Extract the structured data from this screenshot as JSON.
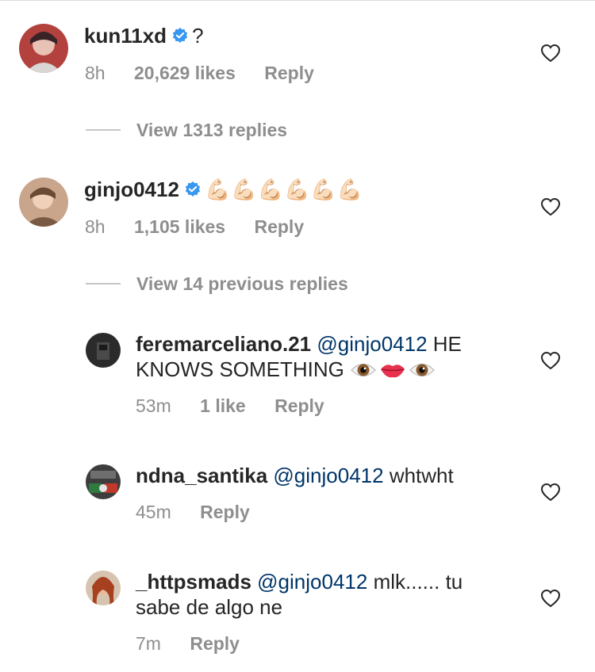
{
  "comments": [
    {
      "username": "kun11xd",
      "text": "?",
      "time": "8h",
      "likes": "20,629 likes",
      "reply": "Reply",
      "view_replies": "View 1313 replies"
    },
    {
      "username": "ginjo0412",
      "emoji": "💪🏻💪🏻💪🏻💪🏻💪🏻💪🏻",
      "time": "8h",
      "likes": "1,105 likes",
      "reply": "Reply",
      "view_replies": "View 14 previous replies"
    }
  ],
  "replies": [
    {
      "username": "feremarceliano.21",
      "mention": "@ginjo0412",
      "text_line1": "HE",
      "text_line2": "KNOWS SOMETHING",
      "time": "53m",
      "likes": "1 like",
      "reply": "Reply"
    },
    {
      "username": "ndna_santika",
      "mention": "@ginjo0412",
      "text": "whtwht",
      "time": "45m",
      "reply": "Reply"
    },
    {
      "username": "_httpsmads",
      "mention": "@ginjo0412",
      "text_line1": "mlk...... tu",
      "text_line2": "sabe de algo ne",
      "time": "7m",
      "reply": "Reply"
    }
  ],
  "icons": {
    "verified": "verified-badge-icon",
    "like": "heart-outline-icon",
    "emoji_eye": "eye-emoji",
    "emoji_lips": "lips-emoji",
    "emoji_muscle": "flexed-biceps-emoji"
  },
  "colors": {
    "username": "#262626",
    "mention": "#003569",
    "meta": "#8e8e8e",
    "verified": "#3897f0"
  }
}
